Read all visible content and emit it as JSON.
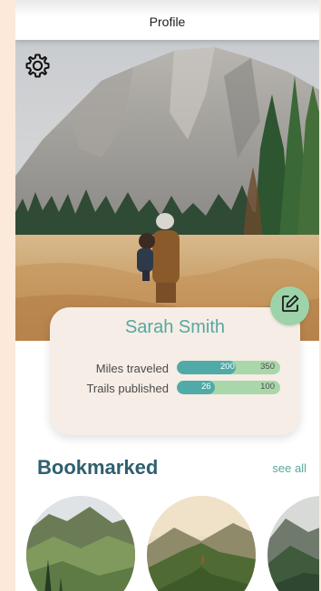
{
  "header": {
    "title": "Profile"
  },
  "profile": {
    "name": "Sarah Smith"
  },
  "stats": [
    {
      "label": "Miles traveled",
      "value": "200",
      "max": "350",
      "fraction": 0.57
    },
    {
      "label": "Trails published",
      "value": "26",
      "max": "100",
      "fraction": 0.26
    }
  ],
  "bookmarked": {
    "title": "Bookmarked",
    "see_all": "see all"
  },
  "icons": {
    "settings": "gear-icon",
    "edit": "edit-note-icon"
  },
  "colors": {
    "accent": "#55a89f",
    "bar_fill": "#50aba8",
    "bar_track": "#a9d7a9",
    "card_bg": "#f5ede6",
    "section_title": "#2f5f6f",
    "edit_button": "#9dd3a8"
  }
}
